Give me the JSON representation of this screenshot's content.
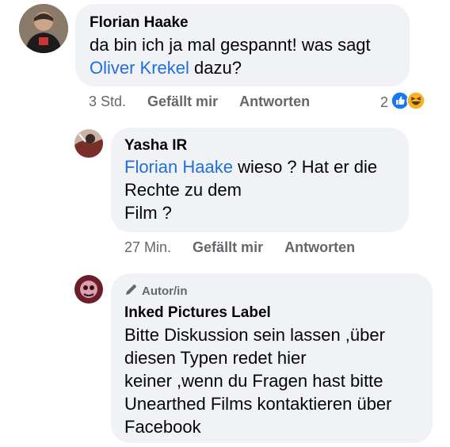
{
  "comments": [
    {
      "author": "Florian Haake",
      "text_before": "da bin ich ja mal gespannt! was sagt",
      "mention": "Oliver Krekel",
      "text_after": " dazu?",
      "time": "3 Std.",
      "like_label": "Gefällt mir",
      "reply_label": "Antworten",
      "reaction_count": "2"
    },
    {
      "author": "Yasha IR",
      "mention": "Florian Haake",
      "text_line1": " wieso ? Hat er die",
      "text_line2": "Rechte zu dem",
      "text_line3": "Film ?",
      "time": "27 Min.",
      "like_label": "Gefällt mir",
      "reply_label": "Antworten"
    },
    {
      "badge": "Autor/in",
      "author": "Inked Pictures Label",
      "lines": [
        "Bitte Diskussion sein lassen ,über",
        "diesen Typen redet hier",
        "keiner ,wenn du Fragen hast bitte",
        "Unearthed Films kontaktieren über",
        "Facebook"
      ]
    }
  ],
  "colors": {
    "bubble": "#f0f2f5",
    "mention": "#216fdb",
    "meta": "#65676b",
    "like": "#1877f2",
    "haha": "#f7b125"
  },
  "icons": [
    "like-reaction-icon",
    "haha-reaction-icon",
    "pencil-icon"
  ]
}
